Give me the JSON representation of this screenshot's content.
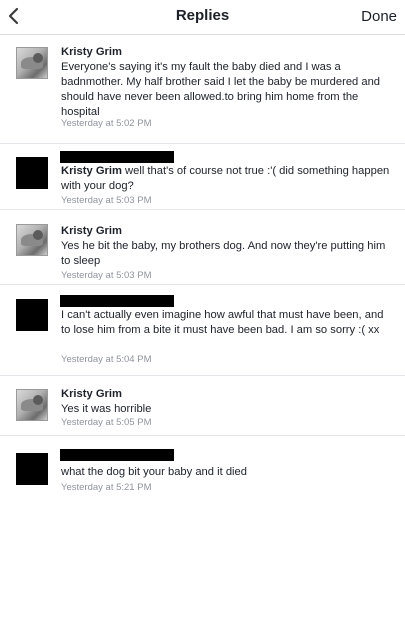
{
  "header": {
    "title": "Replies",
    "done_label": "Done",
    "back_icon": "chevron-left-icon"
  },
  "replies": [
    {
      "author": "Kristy Grim",
      "text": "Everyone's saying it's my fault the baby died and I was a badnmother. My half brother said I let the baby be murdered and should have never been allowed.to bring him home from the hospital",
      "time": "Yesterday at 5:02 PM"
    },
    {
      "author": "Kristy Grim",
      "text": " well that's of course not true :'( did something happen with your dog?",
      "time": "Yesterday at 5:03 PM"
    },
    {
      "author": "Kristy Grim",
      "text": "Yes he bit the baby, my brothers dog. And now they're putting him to sleep",
      "time": "Yesterday at 5:03 PM"
    },
    {
      "author": "",
      "text": "I can't actually even imagine how awful that must have been, and to lose him from a bite it must have been bad. I am so sorry :( xx",
      "time": "Yesterday at 5:04 PM"
    },
    {
      "author": "Kristy Grim",
      "text": "Yes it was horrible",
      "time": "Yesterday at 5:05 PM"
    },
    {
      "author": "",
      "text": "what the dog bit your baby and it died",
      "time": "Yesterday at 5:21 PM"
    }
  ]
}
